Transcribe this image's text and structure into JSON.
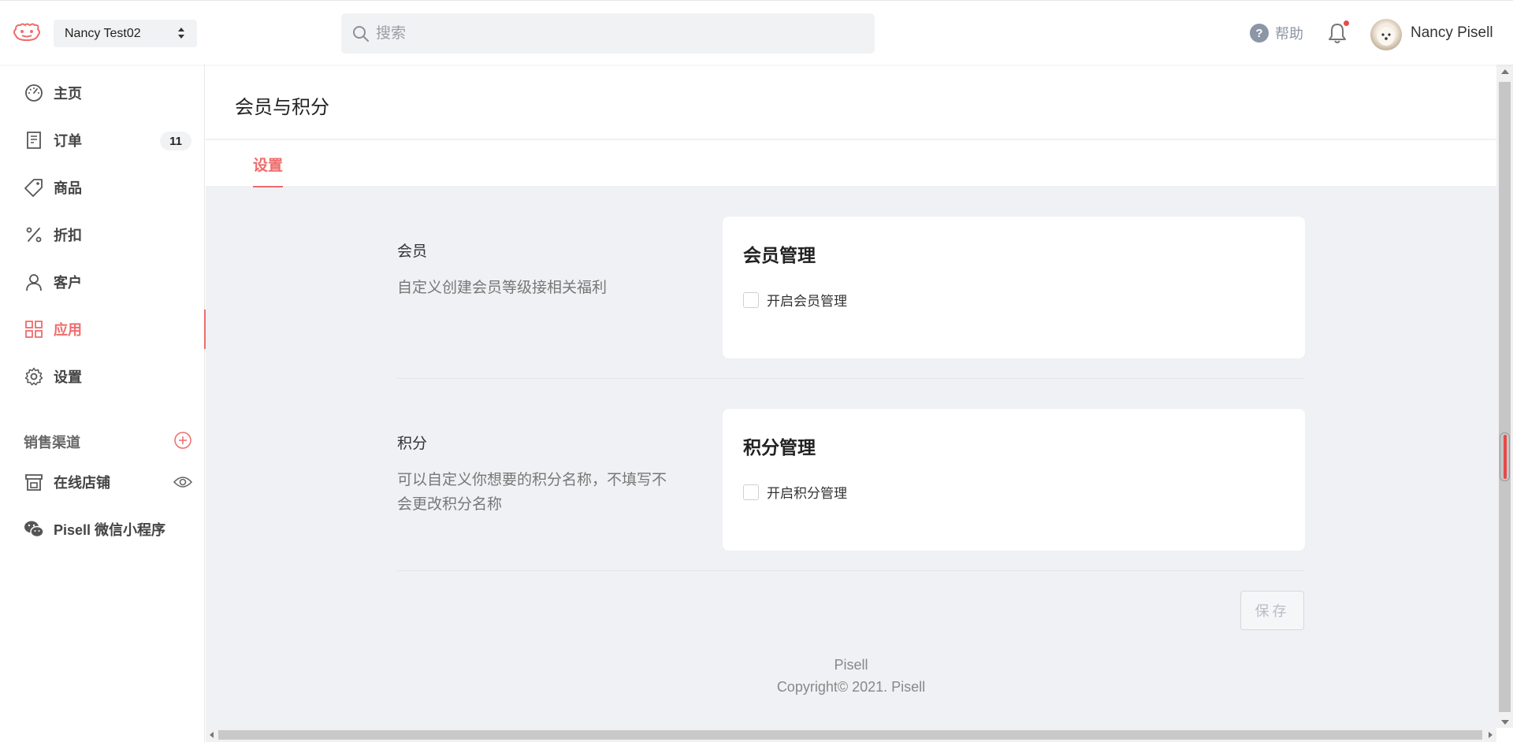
{
  "header": {
    "store_name": "Nancy Test02",
    "search_placeholder": "搜索",
    "help_label": "帮助",
    "user_name": "Nancy Pisell",
    "icons": [
      "pisell-logo-icon",
      "sort-arrows-icon",
      "search-icon",
      "help-circle-icon",
      "bell-icon",
      "avatar"
    ]
  },
  "sidebar": {
    "items": [
      {
        "label": "主页",
        "icon": "dashboard-icon"
      },
      {
        "label": "订单",
        "icon": "receipt-icon",
        "badge": "11"
      },
      {
        "label": "商品",
        "icon": "tag-icon"
      },
      {
        "label": "折扣",
        "icon": "percent-icon"
      },
      {
        "label": "客户",
        "icon": "user-icon"
      },
      {
        "label": "应用",
        "icon": "apps-grid-icon",
        "active": true
      },
      {
        "label": "设置",
        "icon": "gear-icon"
      }
    ],
    "channels_label": "销售渠道",
    "channels": [
      {
        "label": "在线店铺",
        "icon": "store-icon"
      },
      {
        "label": "Pisell 微信小程序",
        "icon": "wechat-icon"
      }
    ]
  },
  "main": {
    "title": "会员与积分",
    "tabs": [
      {
        "label": "设置",
        "active": true
      }
    ],
    "sections": [
      {
        "title": "会员",
        "description": "自定义创建会员等级接相关福利",
        "card_title": "会员管理",
        "checkbox_label": "开启会员管理",
        "checked": false
      },
      {
        "title": "积分",
        "description": "可以自定义你想要的积分名称，不填写不会更改积分名称",
        "card_title": "积分管理",
        "checkbox_label": "开启积分管理",
        "checked": false
      }
    ],
    "save_label": "保存"
  },
  "footer": {
    "brand": "Pisell",
    "copyright": "Copyright© 2021. Pisell"
  },
  "colors": {
    "accent": "#ef6c6c",
    "content_bg": "#f0f1f4",
    "notification_dot": "#e84a4a"
  }
}
